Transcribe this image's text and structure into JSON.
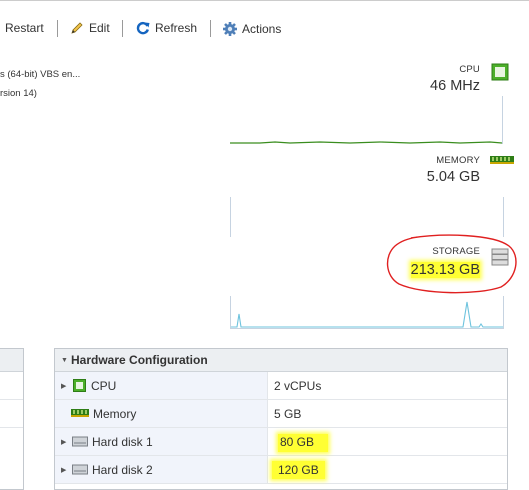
{
  "toolbar": {
    "restart_label": "Restart",
    "edit_label": "Edit",
    "refresh_label": "Refresh",
    "actions_label": "Actions"
  },
  "guest": {
    "os_line": "s (64-bit) VBS en...",
    "compat_line": "rsion 14)"
  },
  "metrics": {
    "cpu": {
      "label": "CPU",
      "value": "46 MHz"
    },
    "memory": {
      "label": "MEMORY",
      "value": "5.04 GB"
    },
    "storage": {
      "label": "STORAGE",
      "value": "213.13 GB"
    }
  },
  "hardware": {
    "title": "Hardware Configuration",
    "rows": [
      {
        "name": "CPU",
        "value": "2 vCPUs",
        "expandable": true,
        "icon": "cpu-icon"
      },
      {
        "name": "Memory",
        "value": "5 GB",
        "expandable": false,
        "icon": "memory-icon"
      },
      {
        "name": "Hard disk 1",
        "value": "80 GB",
        "expandable": true,
        "icon": "hard-disk-icon"
      },
      {
        "name": "Hard disk 2",
        "value": "120 GB",
        "expandable": true,
        "icon": "hard-disk-icon"
      }
    ]
  },
  "colors": {
    "cpu_line": "#3a8d1e",
    "storage_line": "#6ec3de",
    "refresh_icon": "#1565c0",
    "highlight": "#ffff33",
    "annotation": "#e02020"
  }
}
